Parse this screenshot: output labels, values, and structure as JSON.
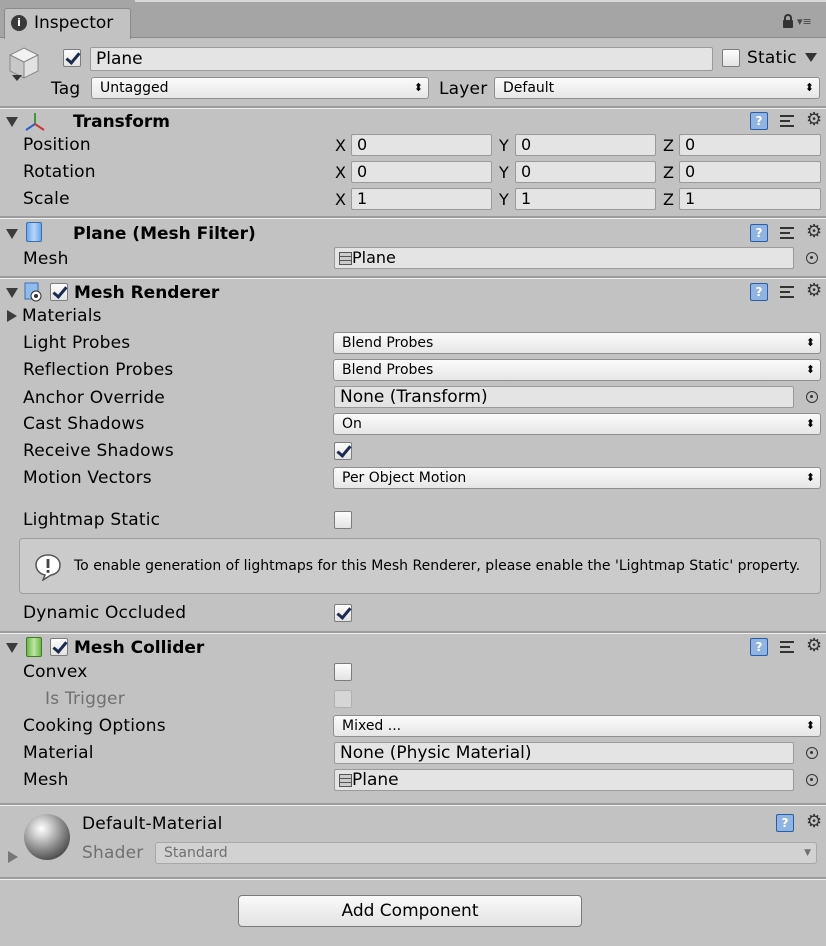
{
  "tab": {
    "title": "Inspector"
  },
  "object": {
    "name": "Plane",
    "static_label": "Static",
    "tag_label": "Tag",
    "tag_value": "Untagged",
    "layer_label": "Layer",
    "layer_value": "Default"
  },
  "transform": {
    "title": "Transform",
    "position_label": "Position",
    "rotation_label": "Rotation",
    "scale_label": "Scale",
    "axis_x": "X",
    "axis_y": "Y",
    "axis_z": "Z",
    "position": {
      "x": "0",
      "y": "0",
      "z": "0"
    },
    "rotation": {
      "x": "0",
      "y": "0",
      "z": "0"
    },
    "scale": {
      "x": "1",
      "y": "1",
      "z": "1"
    }
  },
  "mesh_filter": {
    "title": "Plane (Mesh Filter)",
    "mesh_label": "Mesh",
    "mesh_value": "Plane"
  },
  "mesh_renderer": {
    "title": "Mesh Renderer",
    "materials_label": "Materials",
    "light_probes_label": "Light Probes",
    "light_probes_value": "Blend Probes",
    "reflection_probes_label": "Reflection Probes",
    "reflection_probes_value": "Blend Probes",
    "anchor_override_label": "Anchor Override",
    "anchor_override_value": "None (Transform)",
    "cast_shadows_label": "Cast Shadows",
    "cast_shadows_value": "On",
    "receive_shadows_label": "Receive Shadows",
    "motion_vectors_label": "Motion Vectors",
    "motion_vectors_value": "Per Object Motion",
    "lightmap_static_label": "Lightmap Static",
    "info_message": "To enable generation of lightmaps for this Mesh Renderer, please enable the 'Lightmap Static' property.",
    "dynamic_occluded_label": "Dynamic Occluded"
  },
  "mesh_collider": {
    "title": "Mesh Collider",
    "convex_label": "Convex",
    "is_trigger_label": "Is Trigger",
    "cooking_options_label": "Cooking Options",
    "cooking_options_value": "Mixed ...",
    "material_label": "Material",
    "material_value": "None (Physic Material)",
    "mesh_label": "Mesh",
    "mesh_value": "Plane"
  },
  "material": {
    "name": "Default-Material",
    "shader_label": "Shader",
    "shader_value": "Standard"
  },
  "add_component": {
    "label": "Add Component"
  },
  "colors": {
    "background": "#c2c2c2",
    "help_icon": "#8fb3e3",
    "check": "#1a2b50"
  }
}
